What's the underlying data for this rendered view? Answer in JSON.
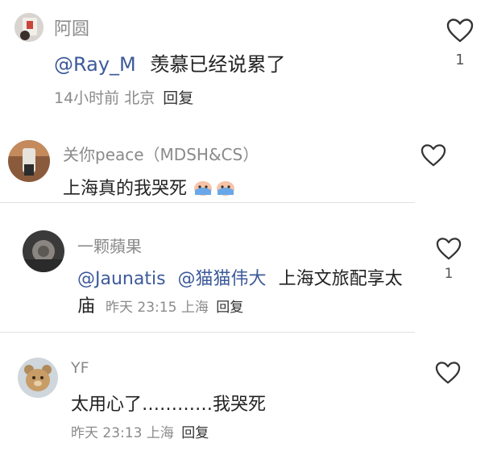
{
  "comments": [
    {
      "author": "阿圆",
      "mention": "@Ray_M",
      "text": "羡慕已经说累了",
      "time": "14小时前",
      "location": "北京",
      "reply_label": "回复",
      "likes": "1",
      "avatar_icon": "avatar-photo-icon"
    },
    {
      "author": "关你peace（MDSH&CS）",
      "text": "上海真的我哭死",
      "emoji_icon": "crying-face-emoji-icon"
    },
    {
      "author": "一颗蘋果",
      "mention1": "@Jaunatis",
      "mention2": "@猫猫伟大",
      "text_line1": "上海文旅配享太",
      "text_line2": "庙",
      "time": "昨天 23:15",
      "location": "上海",
      "reply_label": "回复",
      "likes": "1"
    },
    {
      "author": "YF",
      "text": "太用心了…………我哭死",
      "time": "昨天 23:13",
      "location": "上海",
      "reply_label": "回复"
    }
  ],
  "colors": {
    "mention": "#3d5a9a",
    "meta": "#8a8a8a",
    "divider": "#e2e2e2"
  }
}
